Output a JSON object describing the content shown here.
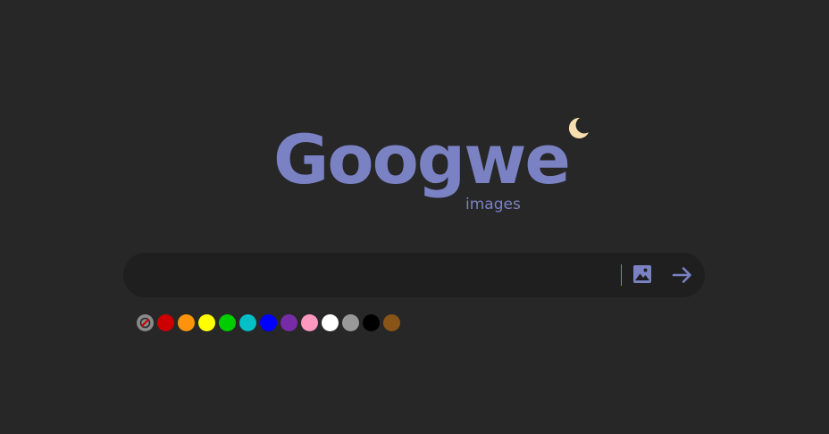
{
  "logo": {
    "word": "Googwe",
    "subtitle": "images"
  },
  "theme_toggle": {
    "icon": "moon-icon",
    "color": "#f9dfb0"
  },
  "search": {
    "value": "",
    "placeholder": "",
    "image_search_icon": "image-icon",
    "submit_icon": "arrow-right-icon"
  },
  "colors": {
    "background": "#272727",
    "searchbar": "#1f1f1f",
    "accent": "#7a82c4"
  },
  "color_filter": {
    "swatches": [
      {
        "name": "none",
        "color": "#8a8a8a"
      },
      {
        "name": "red",
        "color": "#cc0000"
      },
      {
        "name": "orange",
        "color": "#fb940b"
      },
      {
        "name": "yellow",
        "color": "#ffff00"
      },
      {
        "name": "green",
        "color": "#00cc00"
      },
      {
        "name": "teal",
        "color": "#03c0c6"
      },
      {
        "name": "blue",
        "color": "#0000ff"
      },
      {
        "name": "purple",
        "color": "#762ca7"
      },
      {
        "name": "pink",
        "color": "#ff98bf"
      },
      {
        "name": "white",
        "color": "#ffffff"
      },
      {
        "name": "gray",
        "color": "#999999"
      },
      {
        "name": "black",
        "color": "#000000"
      },
      {
        "name": "brown",
        "color": "#885418"
      }
    ]
  }
}
